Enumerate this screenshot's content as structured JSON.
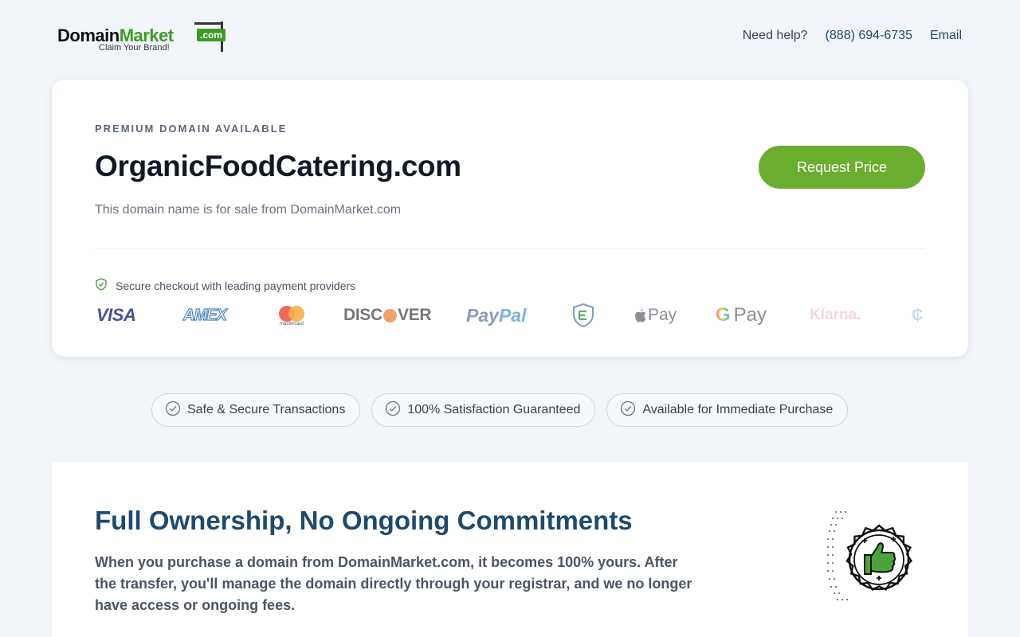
{
  "header": {
    "logo": {
      "domain": "Domain",
      "market": "Market",
      "com": ".com",
      "tagline": "Claim Your Brand!"
    },
    "help_label": "Need help?",
    "phone": "(888) 694-6735",
    "email_label": "Email"
  },
  "listing": {
    "eyebrow": "PREMIUM DOMAIN AVAILABLE",
    "domain_name": "OrganicFoodCatering.com",
    "subtitle": "This domain name is for sale from DomainMarket.com",
    "cta_label": "Request Price",
    "secure_text": "Secure checkout with leading payment providers",
    "payment_icons": [
      "visa-icon",
      "amex-icon",
      "mastercard-icon",
      "discover-icon",
      "paypal-icon",
      "escrow-icon",
      "apple-pay-icon",
      "google-pay-icon",
      "klarna-icon",
      "crypto-icon"
    ],
    "payment_labels": {
      "visa": "VISA",
      "amex": "AMEX",
      "mastercard": "mastercard",
      "discover_a": "DISC",
      "discover_b": "VER",
      "paypal_a": "Pay",
      "paypal_b": "Pal",
      "apple_pay": "Pay",
      "google_pay": "Pay",
      "klarna": "Klarna."
    }
  },
  "badges": [
    {
      "label": "Safe & Secure Transactions"
    },
    {
      "label": "100% Satisfaction Guaranteed"
    },
    {
      "label": "Available for Immediate Purchase"
    }
  ],
  "ownership": {
    "title": "Full Ownership, No Ongoing Commitments",
    "body": "When you purchase a domain from DomainMarket.com, it becomes 100% yours. After the transfer, you'll manage the domain directly through your registrar, and we no longer have access or ongoing fees."
  },
  "colors": {
    "brand_green": "#6aad2f",
    "navy": "#1e4a6e",
    "link": "#234a6b"
  }
}
